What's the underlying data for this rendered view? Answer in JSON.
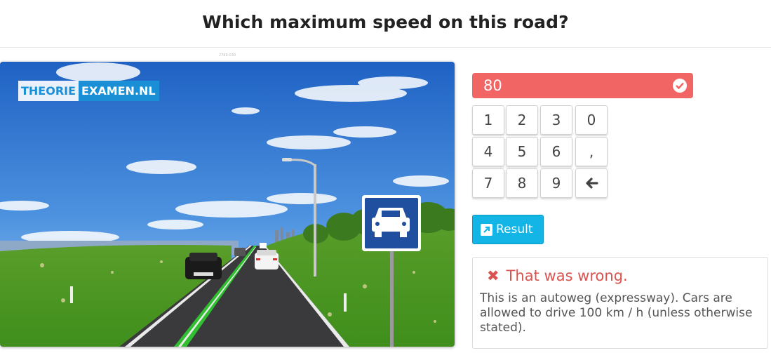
{
  "question": {
    "title": "Which maximum speed on this road?",
    "caption": "2769-030"
  },
  "logo": {
    "part1": "THEORIE",
    "part2": "EXAMEN.NL"
  },
  "scene": {
    "icons": [
      "autoweg-sign-icon",
      "street-lamp-icon"
    ]
  },
  "answer": {
    "value": "80",
    "status_icon": "check-circle-icon",
    "color": "#f26565"
  },
  "keypad": {
    "keys": [
      {
        "label": "1",
        "name": "key-1"
      },
      {
        "label": "2",
        "name": "key-2"
      },
      {
        "label": "3",
        "name": "key-3"
      },
      {
        "label": "0",
        "name": "key-0"
      },
      {
        "label": "4",
        "name": "key-4"
      },
      {
        "label": "5",
        "name": "key-5"
      },
      {
        "label": "6",
        "name": "key-6"
      },
      {
        "label": ",",
        "name": "key-comma"
      },
      {
        "label": "7",
        "name": "key-7"
      },
      {
        "label": "8",
        "name": "key-8"
      },
      {
        "label": "9",
        "name": "key-9"
      },
      {
        "label": "🡰",
        "name": "key-backspace"
      }
    ]
  },
  "result_button": {
    "label": "Result",
    "icon": "external-link-icon",
    "color": "#13b4e6"
  },
  "feedback": {
    "title": "That was wrong.",
    "icon": "cross-icon",
    "text": "This is an autoweg (expressway). Cars are allowed to drive 100 km / h (unless otherwise stated).",
    "color": "#d9534f"
  }
}
